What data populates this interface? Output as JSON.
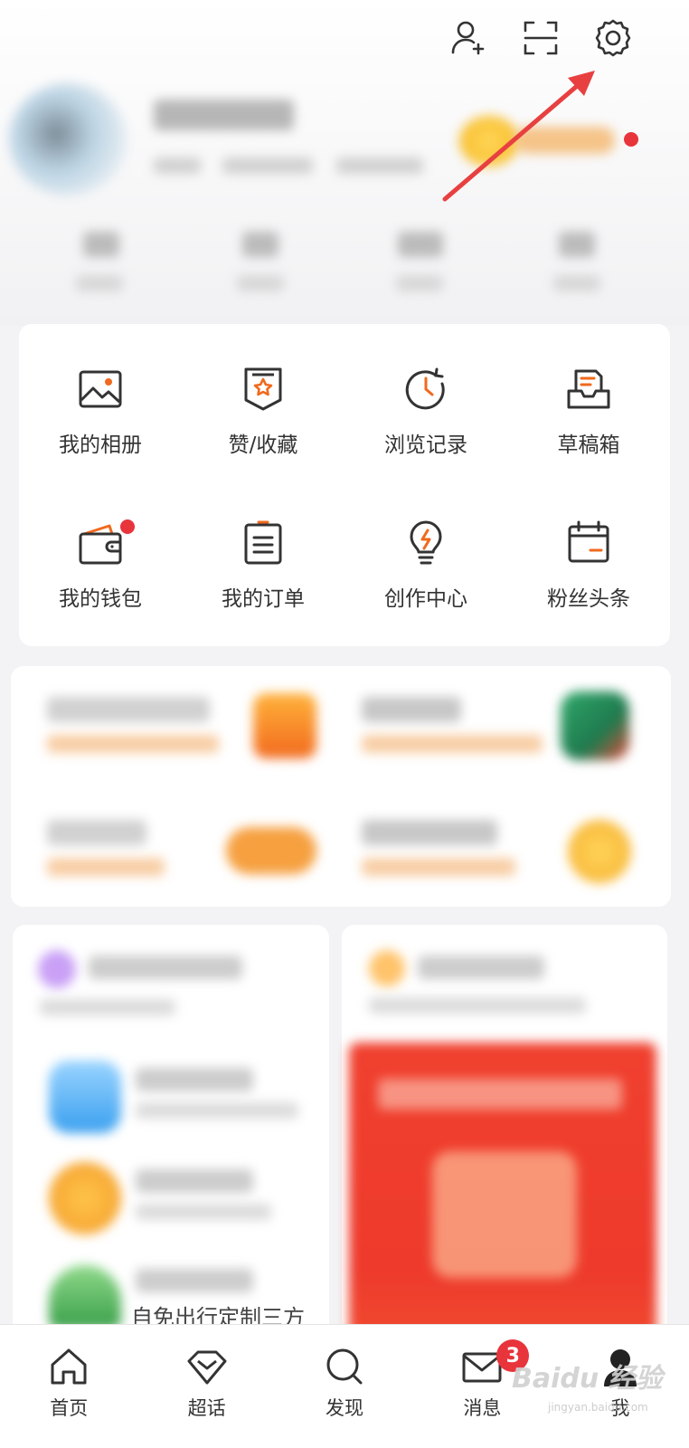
{
  "header": {
    "icons": [
      "add-friend-icon",
      "scan-icon",
      "settings-icon"
    ]
  },
  "colors": {
    "accent": "#f06a1e",
    "icon_stroke": "#333333",
    "badge": "#e8343b",
    "annotation_arrow": "#e84040"
  },
  "grid": {
    "items": [
      {
        "label": "我的相册",
        "icon": "photo-album-icon"
      },
      {
        "label": "赞/收藏",
        "icon": "like-favorite-icon"
      },
      {
        "label": "浏览记录",
        "icon": "history-clock-icon"
      },
      {
        "label": "草稿箱",
        "icon": "drafts-inbox-icon"
      },
      {
        "label": "我的钱包",
        "icon": "wallet-icon"
      },
      {
        "label": "我的订单",
        "icon": "orders-clipboard-icon"
      },
      {
        "label": "创作中心",
        "icon": "creator-bulb-icon"
      },
      {
        "label": "粉丝头条",
        "icon": "fans-headline-calendar-icon"
      }
    ]
  },
  "feed": {
    "partial_text": "自免出行定制三方"
  },
  "tabbar": {
    "items": [
      {
        "label": "首页",
        "icon": "home-icon"
      },
      {
        "label": "超话",
        "icon": "diamond-icon"
      },
      {
        "label": "发现",
        "icon": "search-icon"
      },
      {
        "label": "消息",
        "icon": "mail-icon",
        "badge": "3"
      },
      {
        "label": "我",
        "icon": "profile-icon"
      }
    ]
  },
  "watermark": {
    "logo": "Baidu 经验",
    "url": "jingyan.baidu.com"
  }
}
